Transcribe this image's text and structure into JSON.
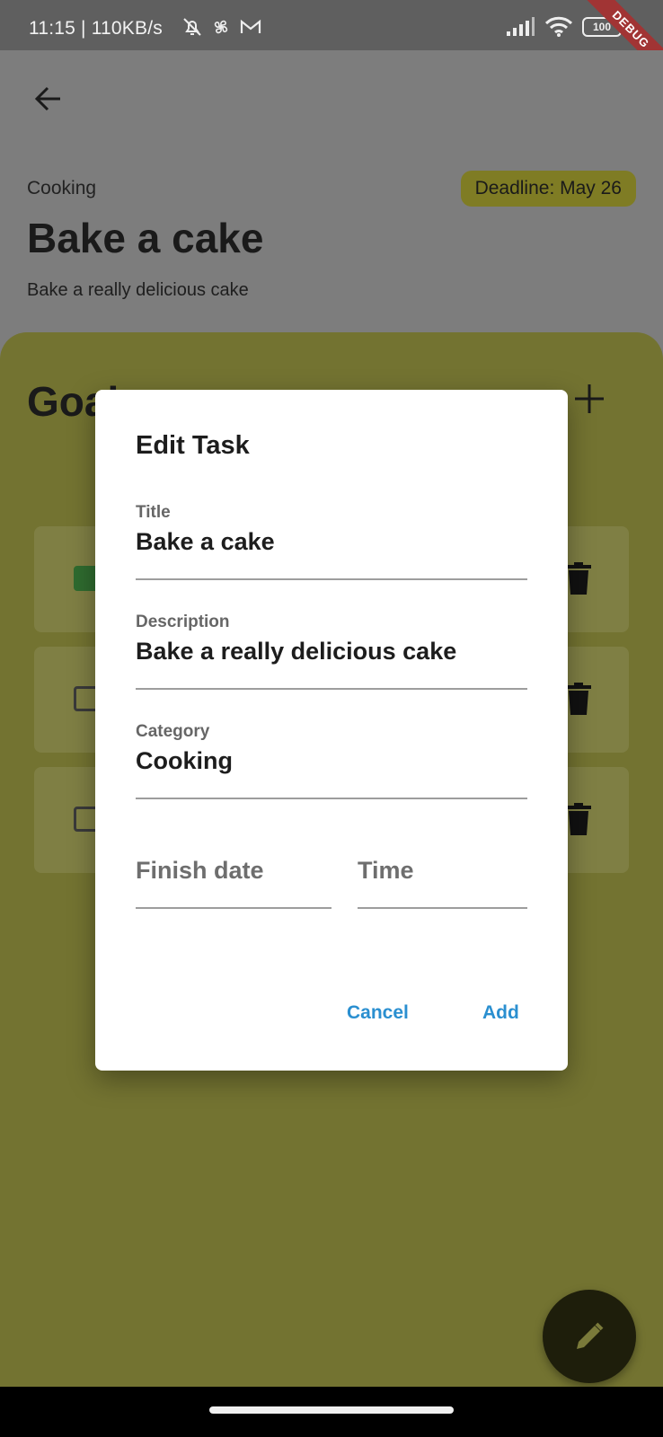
{
  "status_bar": {
    "time": "11:15 | 110KB/s",
    "battery": "100",
    "debug_banner": "DEBUG"
  },
  "header": {
    "category": "Cooking",
    "deadline": "Deadline: May 26",
    "title": "Bake a cake",
    "description": "Bake a really delicious cake"
  },
  "goals": {
    "title": "Goals",
    "items": [
      {
        "checked": true
      },
      {
        "checked": false
      },
      {
        "checked": false
      }
    ]
  },
  "dialog": {
    "title": "Edit Task",
    "fields": {
      "title": {
        "label": "Title",
        "value": "Bake a cake"
      },
      "description": {
        "label": "Description",
        "value": "Bake a really delicious cake"
      },
      "category": {
        "label": "Category",
        "value": "Cooking"
      },
      "finish_date": {
        "placeholder": "Finish date"
      },
      "time": {
        "placeholder": "Time"
      }
    },
    "cancel_label": "Cancel",
    "add_label": "Add"
  },
  "colors": {
    "accent": "#2a8fd0",
    "panel": "#737331",
    "chip": "#7f7c24",
    "fab": "#1e1e0b"
  }
}
